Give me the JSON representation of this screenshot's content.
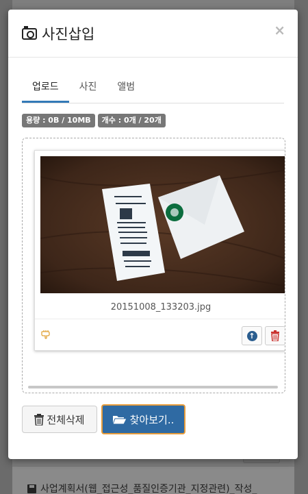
{
  "modal": {
    "title": "사진삽입",
    "close_label": "×",
    "tabs": [
      {
        "label": "업로드",
        "active": true
      },
      {
        "label": "사진",
        "active": false
      },
      {
        "label": "앨범",
        "active": false
      }
    ],
    "badges": {
      "capacity": "용량 : 0B / 10MB",
      "count": "개수 : 0개 / 20개"
    },
    "file": {
      "name": "20151008_133203.jpg",
      "thumb_description": "starbucks-receipt-photo"
    },
    "buttons": {
      "delete_all": "전체삭제",
      "browse": "찾아보기.."
    }
  },
  "background": {
    "file_link": "사업계획서(웹_접근성_품질인증기관_지정관련)_작성_"
  },
  "icons": {
    "title": "camera-icon",
    "drag": "hand-pointer-icon",
    "upload": "arrow-up-circle-icon",
    "delete": "trash-icon",
    "delete_all": "trash-icon",
    "browse": "folder-open-icon",
    "background_file": "floppy-disk-icon"
  },
  "colors": {
    "primary": "#2f6aa3",
    "active_tab": "#337ab7",
    "badge": "#777777",
    "focus_ring": "#e89c3a",
    "danger": "#c9302c"
  }
}
